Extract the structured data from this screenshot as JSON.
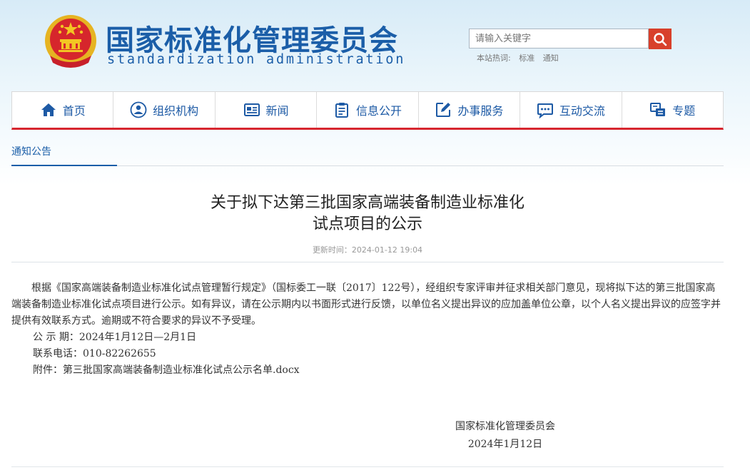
{
  "site": {
    "title_cn": "国家标准化管理委员会",
    "title_en": "standardization administration"
  },
  "search": {
    "placeholder": "请输入关键字",
    "hot_label": "本站热词:",
    "hot_words": [
      "标准",
      "通知"
    ]
  },
  "nav": {
    "items": [
      {
        "label": "首页",
        "icon": "home-icon"
      },
      {
        "label": "组织机构",
        "icon": "organization-icon"
      },
      {
        "label": "新闻",
        "icon": "news-icon"
      },
      {
        "label": "信息公开",
        "icon": "clipboard-icon"
      },
      {
        "label": "办事服务",
        "icon": "edit-icon"
      },
      {
        "label": "互动交流",
        "icon": "chat-icon"
      },
      {
        "label": "专题",
        "icon": "topics-icon"
      }
    ]
  },
  "breadcrumb": {
    "label": "通知公告"
  },
  "article": {
    "title_line1": "关于拟下达第三批国家高端装备制造业标准化",
    "title_line2": "试点项目的公示",
    "update_time": "更新时间：2024-01-12 19:04",
    "body": "根据《国家高端装备制造业标准化试点管理暂行规定》（国标委工一联〔2017〕122号），经组织专家评审并征求相关部门意见，现将拟下达的第三批国家高端装备制造业标准化试点项目进行公示。如有异议，请在公示期内以书面形式进行反馈，以单位名义提出异议的应加盖单位公章，以个人名义提出异议的应签字并提供有效联系方式。逾期或不符合要求的异议不予受理。",
    "period": "公 示 期：2024年1月12日—2月1日",
    "phone": "联系电话：010-82262655",
    "attachment_label": "附件：",
    "attachment_file": "第三批国家高端装备制造业标准化试点公示名单.docx",
    "signature_org": "国家标准化管理委员会",
    "signature_date": "2024年1月12日"
  },
  "colors": {
    "brand_blue": "#1b5ea8",
    "nav_red": "#d7262f",
    "search_red": "#d8402b"
  }
}
